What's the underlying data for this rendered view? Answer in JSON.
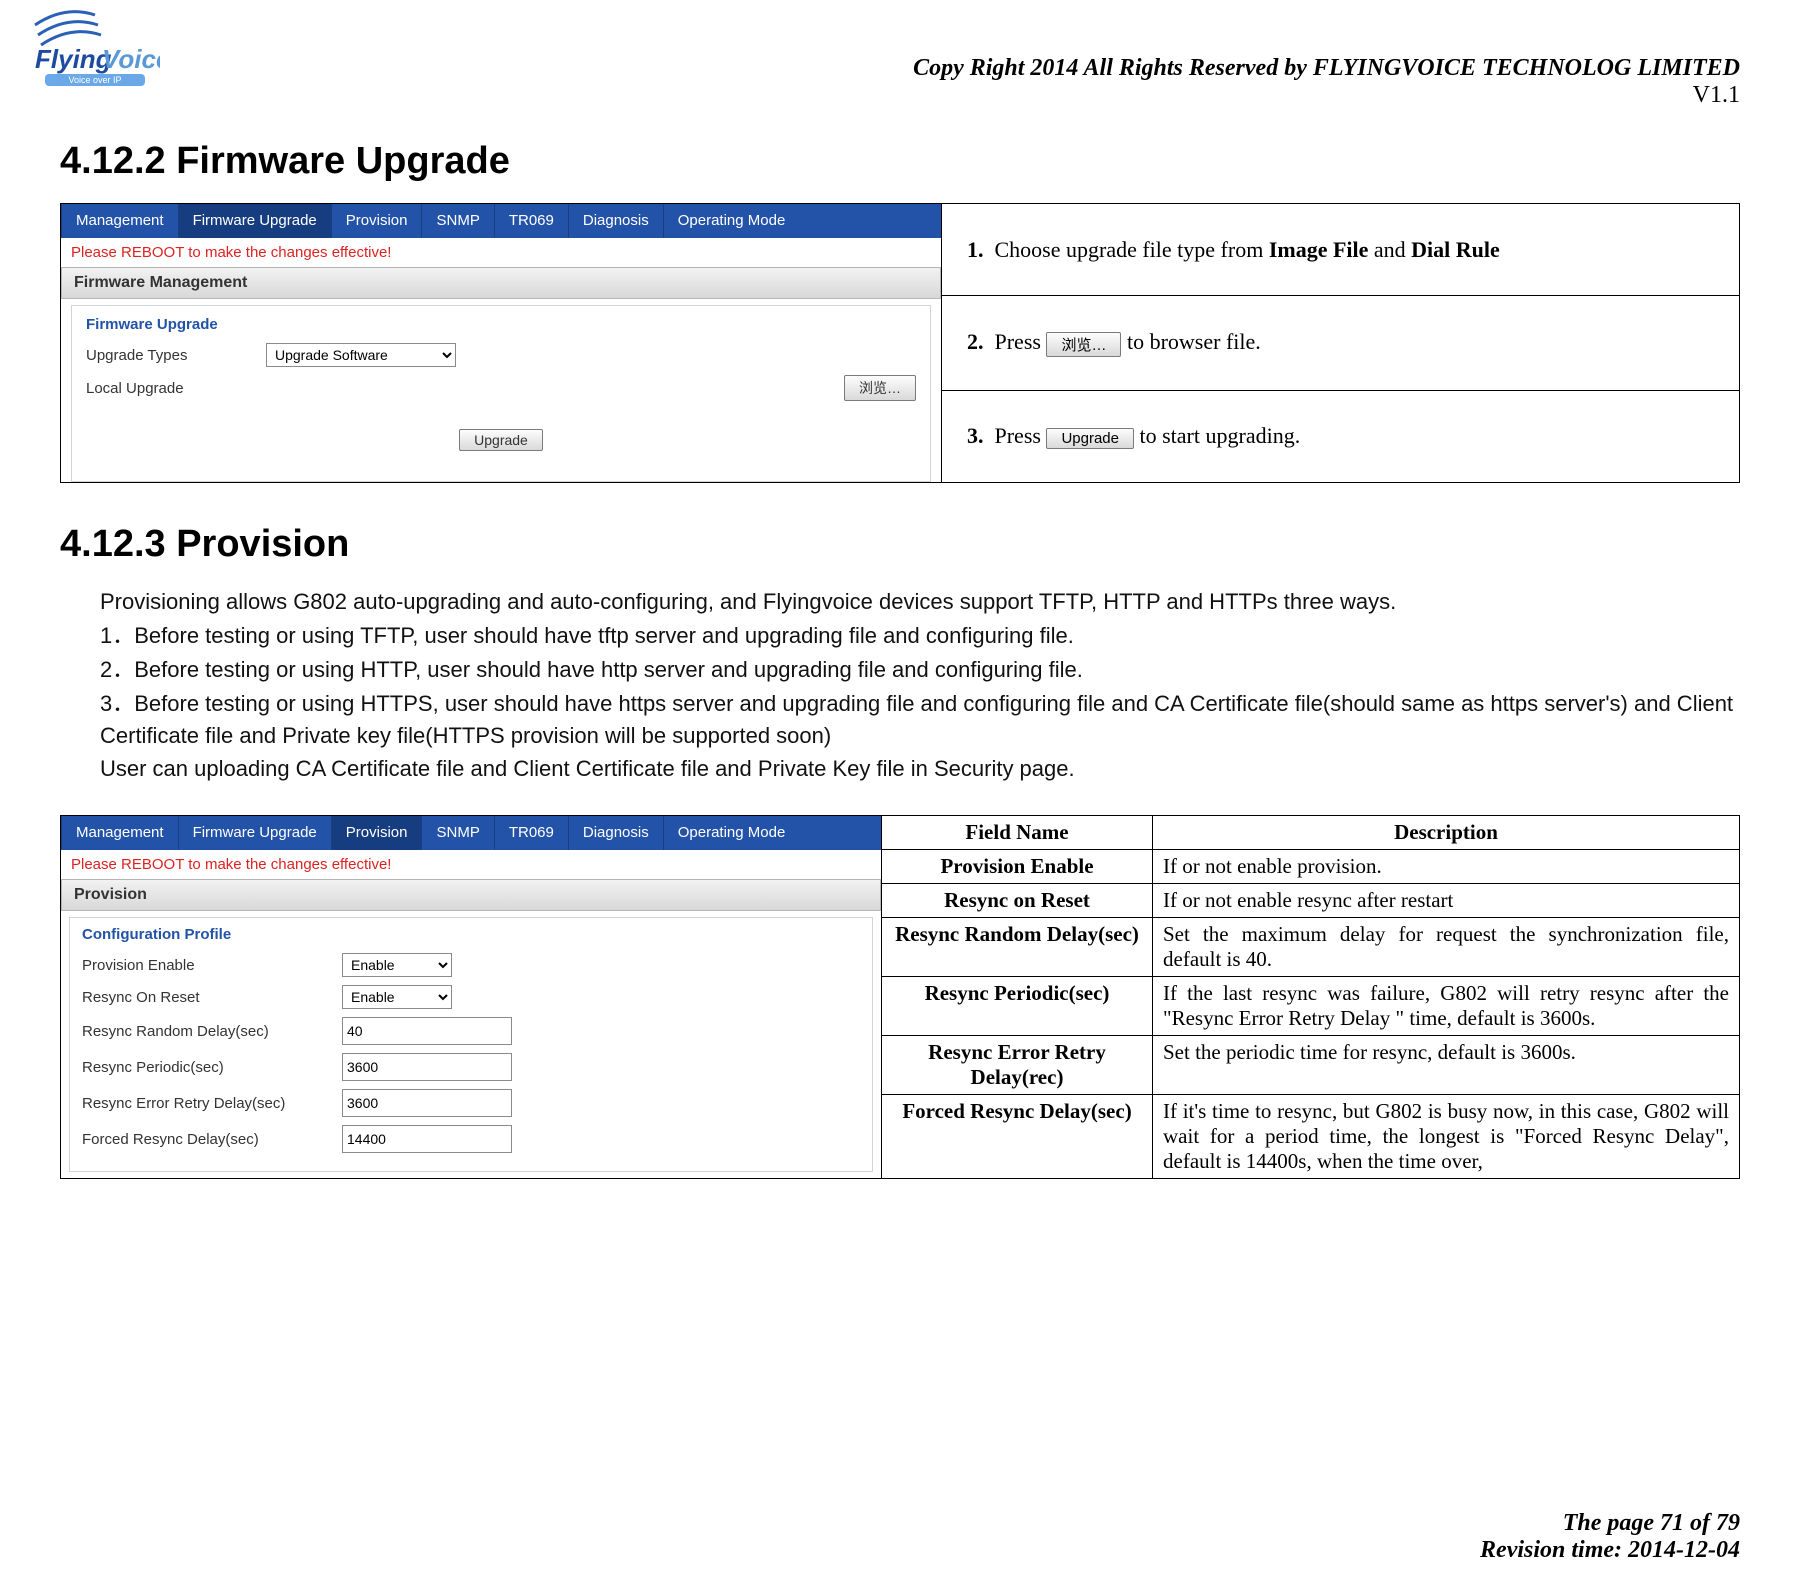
{
  "header": {
    "logo_text": "FlyingVoice",
    "logo_sub": "Voice over IP",
    "copyright": "Copy Right 2014 All Rights Reserved by FLYINGVOICE TECHNOLOG LIMITED",
    "version": "V1.1"
  },
  "section_firmware": {
    "heading": "4.12.2  Firmware Upgrade",
    "screenshot": {
      "tabs": [
        "Management",
        "Firmware Upgrade",
        "Provision",
        "SNMP",
        "TR069",
        "Diagnosis",
        "Operating Mode"
      ],
      "active_tab": "Firmware Upgrade",
      "reboot_msg": "Please REBOOT to make the changes effective!",
      "panel_title": "Firmware Management",
      "sub_title": "Firmware Upgrade",
      "upgrade_types_label": "Upgrade Types",
      "upgrade_types_value": "Upgrade Software",
      "local_upgrade_label": "Local Upgrade",
      "browse_label": "浏览…",
      "upgrade_btn": "Upgrade"
    },
    "steps": {
      "s1_num": "1.",
      "s1_a": "Choose upgrade file type from ",
      "s1_b": "Image File",
      "s1_c": " and ",
      "s1_d": "Dial Rule",
      "s2_num": "2.",
      "s2_a": "Press ",
      "s2_btn": "浏览…",
      "s2_b": " to browser file.",
      "s3_num": "3.",
      "s3_a": "Press ",
      "s3_btn": "Upgrade",
      "s3_b": " to start upgrading."
    }
  },
  "section_provision": {
    "heading": "4.12.3  Provision",
    "body": {
      "p0": "Provisioning allows G802 auto-upgrading and auto-configuring, and Flyingvoice devices support TFTP, HTTP and HTTPs three ways.",
      "p1": "1．Before testing or using TFTP, user should have tftp server and upgrading file and configuring file.",
      "p2": "2．Before testing or using HTTP, user should have http server and upgrading file and configuring file.",
      "p3": "3．Before testing or using HTTPS, user should have https server and upgrading file and configuring file and CA Certificate file(should same as https server's) and Client Certificate file and Private key file(HTTPS provision will be supported soon)",
      "p4": "User can uploading CA Certificate file and Client Certificate file and Private Key file in Security page."
    },
    "screenshot": {
      "tabs": [
        "Management",
        "Firmware Upgrade",
        "Provision",
        "SNMP",
        "TR069",
        "Diagnosis",
        "Operating Mode"
      ],
      "active_tab": "Provision",
      "reboot_msg": "Please REBOOT to make the changes effective!",
      "panel_title": "Provision",
      "sub_title": "Configuration Profile",
      "rows": [
        {
          "label": "Provision Enable",
          "value": "Enable",
          "type": "select"
        },
        {
          "label": "Resync On Reset",
          "value": "Enable",
          "type": "select"
        },
        {
          "label": "Resync Random Delay(sec)",
          "value": "40",
          "type": "text"
        },
        {
          "label": "Resync Periodic(sec)",
          "value": "3600",
          "type": "text"
        },
        {
          "label": "Resync Error Retry Delay(sec)",
          "value": "3600",
          "type": "text"
        },
        {
          "label": "Forced Resync Delay(sec)",
          "value": "14400",
          "type": "text"
        }
      ]
    },
    "desc_table": {
      "head_field": "Field Name",
      "head_desc": "Description",
      "rows": [
        {
          "f": "Provision Enable",
          "d": "If or not enable provision."
        },
        {
          "f": "Resync on Reset",
          "d": "If or not enable resync after restart"
        },
        {
          "f": "Resync Random Delay(sec)",
          "d": "Set the maximum delay for request the synchronization file, default is 40."
        },
        {
          "f": "Resync Periodic(sec)",
          "d": "If the last resync was failure, G802 will retry resync after the \"Resync Error Retry Delay \" time, default is 3600s."
        },
        {
          "f": "Resync Error Retry Delay(rec)",
          "d": "Set the periodic time for resync, default is 3600s."
        },
        {
          "f": "Forced Resync Delay(sec)",
          "d": "If it's time to resync, but G802 is busy now, in this case, G802 will wait for a period time, the longest is \"Forced Resync Delay\", default is 14400s, when the time over,"
        }
      ]
    }
  },
  "footer": {
    "page": "The page 71 of 79",
    "rev": "Revision time: 2014-12-04"
  }
}
